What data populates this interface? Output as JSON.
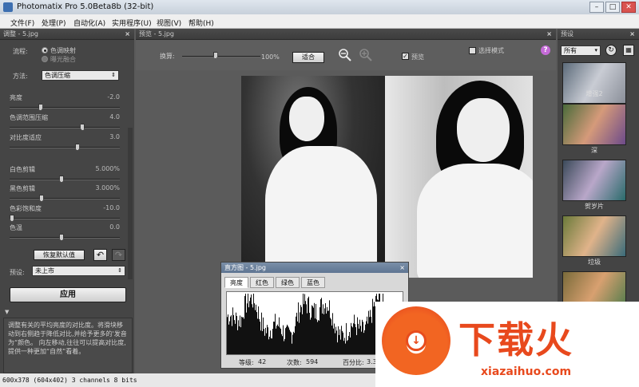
{
  "window": {
    "title": "Photomatix Pro 5.0Beta8b (32-bit)",
    "minimize": "–",
    "maximize": "□",
    "close": "✕"
  },
  "menu": [
    "文件(F)",
    "处理(P)",
    "自动化(A)",
    "实用程序(U)",
    "视图(V)",
    "帮助(H)"
  ],
  "adjust": {
    "panel_title": "调整 - 5.jpg",
    "flow_label": "流程:",
    "flow_options": [
      "色调映射",
      "曝光融合"
    ],
    "method_label": "方法:",
    "method_value": "色调压缩",
    "sliders": [
      {
        "label": "亮度",
        "value": "-2.0",
        "pos": 0.27
      },
      {
        "label": "色调范围压缩",
        "value": "4.0",
        "pos": 0.67
      },
      {
        "label": "对比度适应",
        "value": "3.0",
        "pos": 0.62
      },
      {
        "label": "白色剪辑",
        "value": "5.000%",
        "pos": 0.47
      },
      {
        "label": "黑色剪辑",
        "value": "3.000%",
        "pos": 0.28
      },
      {
        "label": "色彩饱和度",
        "value": "-10.0",
        "pos": 0.0
      },
      {
        "label": "色温",
        "value": "0.0",
        "pos": 0.47
      }
    ],
    "reset_label": "恢复默认值",
    "undo_icon": "↶",
    "redo_icon": "↷",
    "preset_label": "预设:",
    "preset_value": "未上市",
    "apply_label": "应用",
    "info_text": "调整有关的平均亮度的对比度。将滑块移动到右侧趋于降低对比,并给予更多的'发音为“颜色。 向左移动,往往可以提高对比度,提供一种更加“自然”看着。"
  },
  "preview": {
    "panel_title": "预览 - 5.jpg",
    "zoom_label": "换算:",
    "zoom_value": "100%",
    "zoom_pos": 0.42,
    "fit_label": "适合",
    "preview_check_label": "预览",
    "select_mode_label": "选择模式",
    "help_icon": "?"
  },
  "presets": {
    "panel_title": "预设",
    "filter_value": "所有",
    "items": [
      "增强2",
      "深",
      "贺岁片",
      "垃圾",
      ""
    ]
  },
  "histogram": {
    "title": "直方图 - 5.jpg",
    "tabs": [
      "亮度",
      "红色",
      "绿色",
      "蓝色"
    ],
    "level_label": "等级:",
    "level_value": "42",
    "count_label": "次数:",
    "count_value": "594",
    "percent_label": "百分比:",
    "percent_value": "3.36"
  },
  "status": {
    "text": "600x378 (604x402) 3 channels 8 bits"
  },
  "watermark": {
    "brand": "下载火",
    "url": "xiazaihuo.com"
  }
}
